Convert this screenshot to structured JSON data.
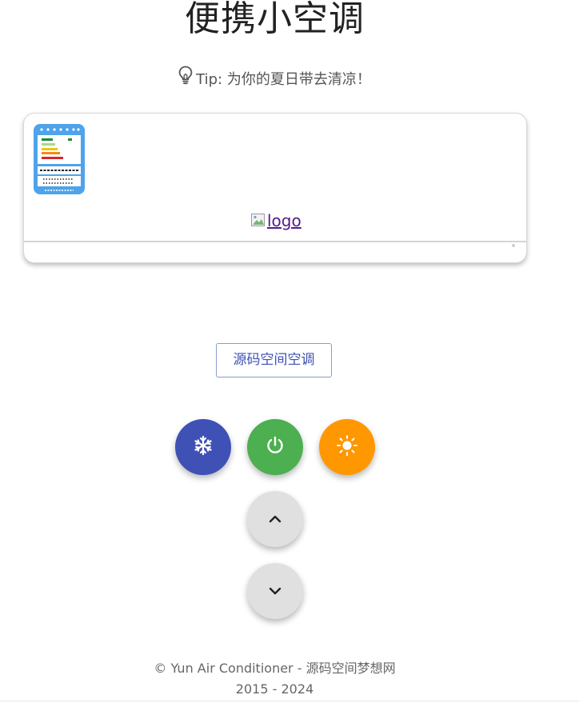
{
  "page": {
    "title": "便携小空调",
    "tip": {
      "icon": "lightbulb-icon",
      "text": "Tip: 为你的夏日带去清凉！"
    }
  },
  "air_conditioner": {
    "energy_label_icon": "energy-label-icon",
    "logo_alt": "logo"
  },
  "controls": {
    "brand_button_label": "源码空间空调",
    "cold_button": {
      "icon": "snowflake-icon",
      "color": "#3f51b5"
    },
    "power_button": {
      "icon": "power-icon",
      "color": "#4caf50"
    },
    "warm_button": {
      "icon": "sun-icon",
      "color": "#ff9800"
    },
    "temp_up_button": {
      "icon": "chevron-up-icon",
      "color": "#e0e0e0"
    },
    "temp_down_button": {
      "icon": "chevron-down-icon",
      "color": "#e0e0e0"
    }
  },
  "footer": {
    "line1": "© Yun Air Conditioner - 源码空间梦想网",
    "line2": "2015 - 2024"
  }
}
